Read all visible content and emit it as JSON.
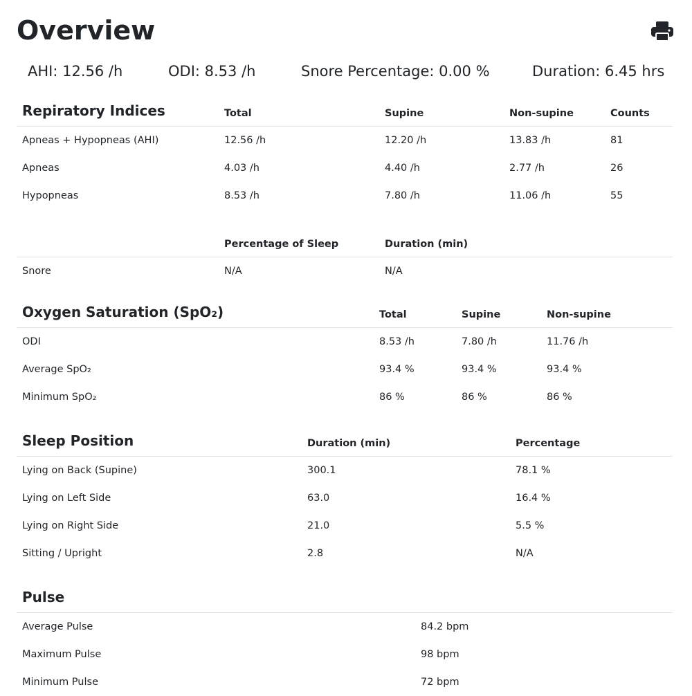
{
  "title": "Overview",
  "print_icon": "printer-icon",
  "summary": {
    "ahi": "AHI: 12.56 /h",
    "odi": "ODI: 8.53 /h",
    "snore": "Snore Percentage: 0.00 %",
    "duration": "Duration: 6.45 hrs"
  },
  "respiratory": {
    "heading": "Repiratory Indices",
    "columns": [
      "Total",
      "Supine",
      "Non-supine",
      "Counts"
    ],
    "rows": [
      [
        "Apneas + Hypopneas (AHI)",
        "12.56 /h",
        "12.20 /h",
        "13.83 /h",
        "81"
      ],
      [
        "Apneas",
        "4.03 /h",
        "4.40 /h",
        "2.77 /h",
        "26"
      ],
      [
        "Hypopneas",
        "8.53 /h",
        "7.80 /h",
        "11.06 /h",
        "55"
      ]
    ]
  },
  "snore_table": {
    "columns": [
      "Percentage of Sleep",
      "Duration (min)"
    ],
    "rows": [
      [
        "Snore",
        "N/A",
        "N/A"
      ]
    ]
  },
  "oxygen": {
    "heading": "Oxygen Saturation (SpO₂)",
    "columns": [
      "Total",
      "Supine",
      "Non-supine"
    ],
    "rows": [
      [
        "ODI",
        "8.53 /h",
        "7.80 /h",
        "11.76 /h"
      ],
      [
        "Average SpO₂",
        "93.4 %",
        "93.4 %",
        "93.4 %"
      ],
      [
        "Minimum SpO₂",
        "86 %",
        "86 %",
        "86 %"
      ]
    ]
  },
  "position": {
    "heading": "Sleep Position",
    "columns": [
      "Duration (min)",
      "Percentage"
    ],
    "rows": [
      [
        "Lying on Back (Supine)",
        "300.1",
        "78.1 %"
      ],
      [
        "Lying on Left Side",
        "63.0",
        "16.4 %"
      ],
      [
        "Lying on Right Side",
        "21.0",
        "5.5 %"
      ],
      [
        "Sitting / Upright",
        "2.8",
        "N/A"
      ]
    ]
  },
  "pulse": {
    "heading": "Pulse",
    "rows": [
      [
        "Average Pulse",
        "84.2 bpm"
      ],
      [
        "Maximum Pulse",
        "98 bpm"
      ],
      [
        "Minimum Pulse",
        "72 bpm"
      ]
    ]
  }
}
